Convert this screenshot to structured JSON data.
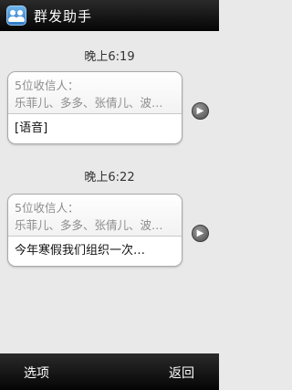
{
  "app": {
    "title": "群发助手",
    "icon": "group-icon"
  },
  "threads": [
    {
      "time": "晚上6:19",
      "recipients_label": "5位收信人：",
      "recipients_names": "乐菲儿、多多、张倩儿、波…",
      "message": "[语音]"
    },
    {
      "time": "晚上6:22",
      "recipients_label": "5位收信人：",
      "recipients_names": "乐菲儿、多多、张倩儿、波…",
      "message": "今年寒假我们组织一次…"
    }
  ],
  "softkeys": {
    "left": "选项",
    "right": "返回"
  }
}
